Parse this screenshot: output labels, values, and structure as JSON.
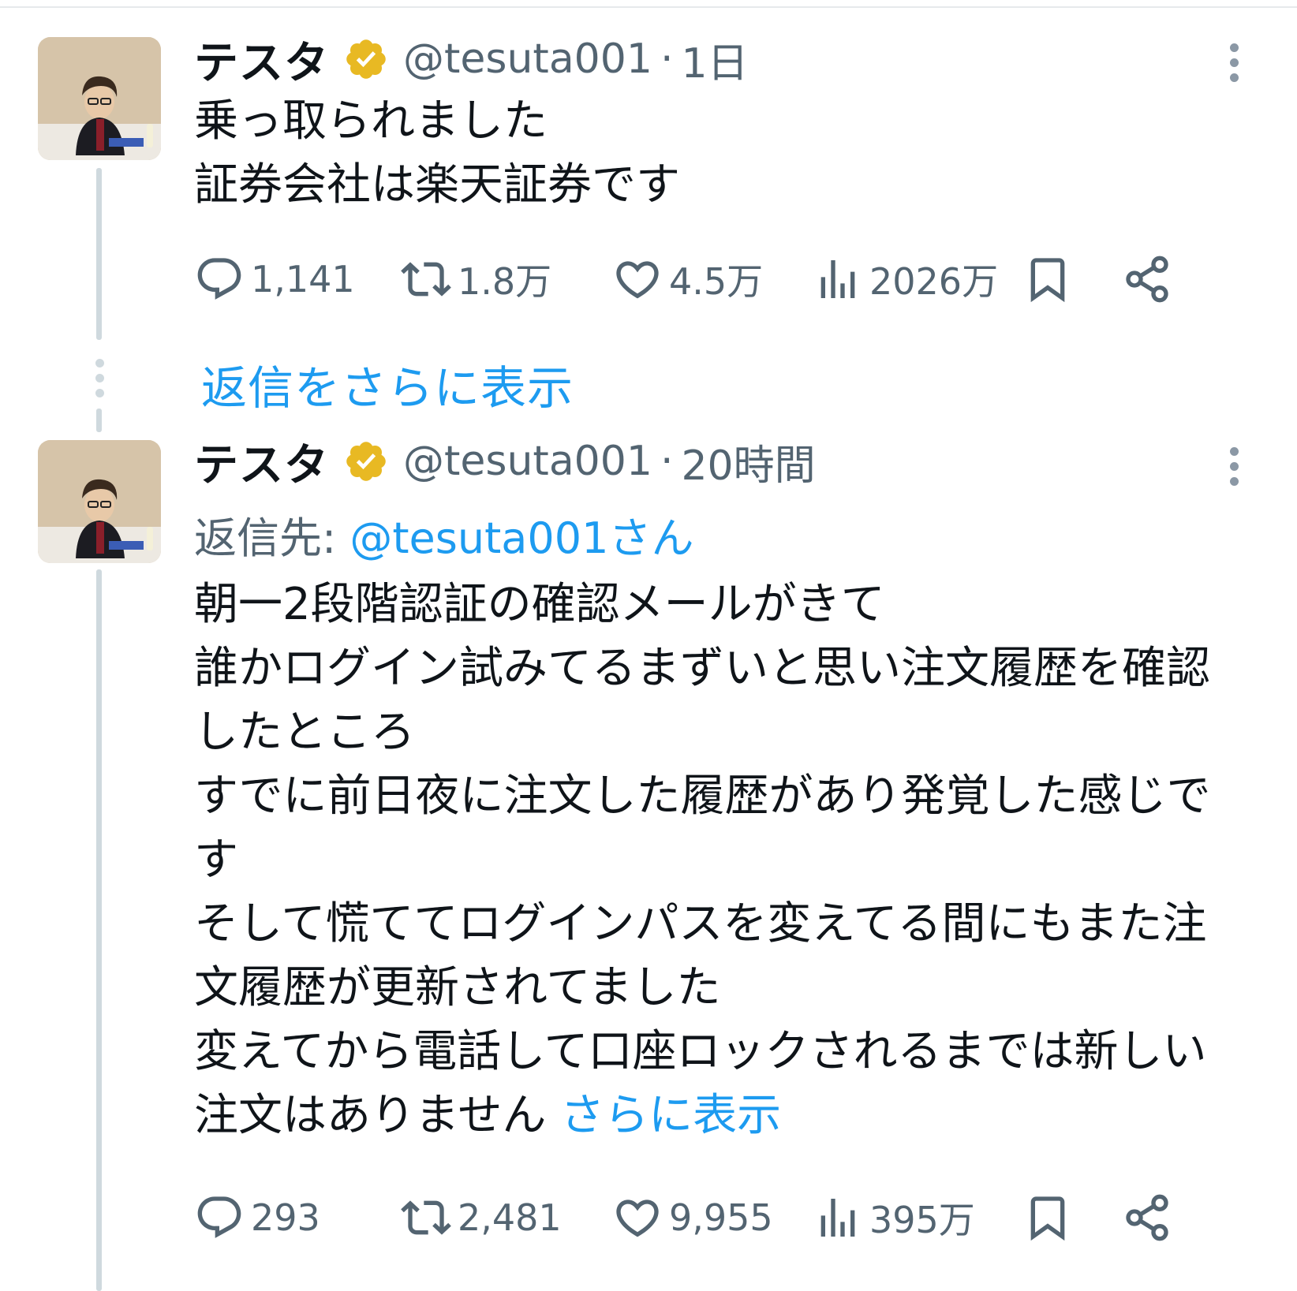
{
  "tweets": [
    {
      "name": "テスタ",
      "handle": "@tesuta001",
      "separator": "·",
      "time": "1日",
      "body": "乗っ取られました\n証券会社は楽天証券です",
      "stats": {
        "replies": "1,141",
        "retweets": "1.8万",
        "likes": "4.5万",
        "views": "2026万"
      }
    },
    {
      "name": "テスタ",
      "handle": "@tesuta001",
      "separator": "·",
      "time": "20時間",
      "reply_label": "返信先: ",
      "reply_target": "@tesuta001さん",
      "body": "朝一2段階認証の確認メールがきて\n誰かログイン試みてるまずいと思い注文履歴を確認したところ\nすでに前日夜に注文した履歴があり発覚した感じです\nそして慌ててログインパスを変えてる間にもまた注文履歴が更新されてました\n変えてから電話して口座ロックされるまでは新しい注文はありません ",
      "show_more": "さらに表示",
      "stats": {
        "replies": "293",
        "retweets": "2,481",
        "likes": "9,955",
        "views": "395万"
      }
    }
  ],
  "show_more_replies": "返信をさらに表示",
  "colors": {
    "accent": "#1d9bf0",
    "muted": "#536471",
    "thread_line": "#cfd9de",
    "verified_badge": "#e8b923"
  },
  "icons": [
    "reply-icon",
    "retweet-icon",
    "like-icon",
    "views-icon",
    "bookmark-icon",
    "share-icon",
    "verified-badge-icon",
    "more-options-icon"
  ]
}
